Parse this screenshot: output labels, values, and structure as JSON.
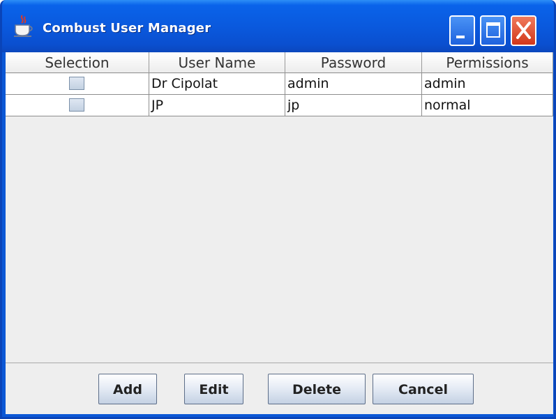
{
  "window": {
    "title": "Combust User Manager",
    "titlebar_color": "#0a58dc"
  },
  "table": {
    "columns": [
      "Selection",
      "User Name",
      "Password",
      "Permissions"
    ],
    "rows": [
      {
        "selected": false,
        "user_name": "Dr Cipolat",
        "password": "admin",
        "permissions": "admin"
      },
      {
        "selected": false,
        "user_name": "JP",
        "password": "jp",
        "permissions": "normal"
      }
    ]
  },
  "buttons": {
    "add": "Add",
    "edit": "Edit",
    "delete": "Delete",
    "cancel": "Cancel"
  },
  "icons": {
    "app": "java-cup-icon",
    "minimize": "minimize-icon",
    "maximize": "maximize-icon",
    "close": "close-icon"
  }
}
